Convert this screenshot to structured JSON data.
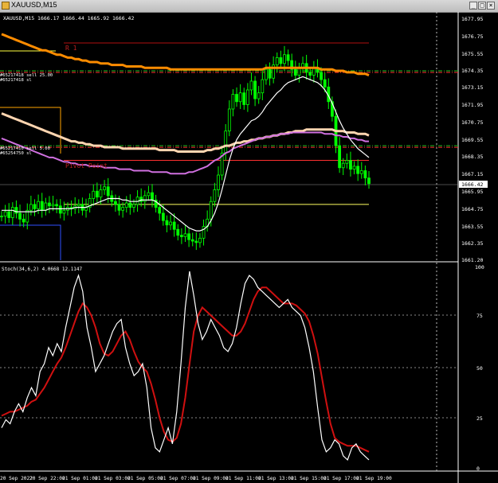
{
  "window": {
    "title": "XAUUSD,M15",
    "min_glyph": "_",
    "max_glyph": "□",
    "close_glyph": "×"
  },
  "price_panel": {
    "ohlc_text": "XAUUSD,M15  1666.17 1666.44 1665.92 1666.42",
    "current_price": "1666.42",
    "price_labels": [
      "1677.95",
      "1676.75",
      "1675.55",
      "1674.35",
      "1673.15",
      "1671.95",
      "1670.75",
      "1669.55",
      "1668.35",
      "1667.15",
      "1665.95",
      "1664.75",
      "1663.55",
      "1662.35",
      "1661.20"
    ],
    "r1_label": "R 1",
    "pivot_label": "Pivot Point",
    "order_labels": [
      "#65217418 sell 25.00",
      "#65217418 sl",
      "#65217410 sell 5.00",
      "#65254750 sl"
    ],
    "colors": {
      "candle": "#00ff00",
      "ma_orange": "#ff8c00",
      "ma_peach": "#ffd5b0",
      "ma_violet": "#d070e0",
      "fast_ma": "#ffffff"
    }
  },
  "stoch_panel": {
    "label": "Stoch(34,6,2) 4.0668 12.1147",
    "levels": [
      "100",
      "75",
      "50",
      "25",
      "0"
    ],
    "colors": {
      "main": "#ffffff",
      "signal": "#d01010"
    }
  },
  "time_axis": {
    "labels": [
      "20 Sep 2022",
      "20 Sep 22:00",
      "21 Sep 01:00",
      "21 Sep 03:00",
      "21 Sep 05:00",
      "21 Sep 07:00",
      "21 Sep 09:00",
      "21 Sep 11:00",
      "21 Sep 13:00",
      "21 Sep 15:00",
      "21 Sep 17:00",
      "21 Sep 19:00"
    ]
  },
  "chart_data": {
    "type": "candlestick",
    "symbol": "XAUUSD",
    "timeframe": "M15",
    "ylim": [
      1661.2,
      1677.95
    ],
    "last_price": 1666.42,
    "levels": {
      "r1": 1676.0,
      "pivot": 1668.0,
      "order_sell_1": 1674.1,
      "order_sell_2": 1669.0,
      "yellow": 1665.0
    },
    "closes": [
      1664.2,
      1664.5,
      1664.1,
      1664.8,
      1664.4,
      1664.0,
      1663.8,
      1664.6,
      1665.0,
      1664.7,
      1665.2,
      1664.6,
      1665.1,
      1664.9,
      1665.0,
      1664.9,
      1664.4,
      1664.6,
      1664.8,
      1664.7,
      1664.9,
      1665.0,
      1664.6,
      1664.8,
      1665.4,
      1665.9,
      1665.5,
      1666.0,
      1666.2,
      1665.6,
      1665.2,
      1665.0,
      1664.6,
      1664.8,
      1665.1,
      1664.8,
      1665.0,
      1665.5,
      1665.2,
      1665.6,
      1665.8,
      1665.3,
      1664.8,
      1664.4,
      1663.9,
      1663.6,
      1663.8,
      1663.3,
      1662.9,
      1662.8,
      1663.0,
      1662.6,
      1662.5,
      1662.4,
      1662.7,
      1663.5,
      1664.0,
      1665.2,
      1666.0,
      1667.0,
      1668.5,
      1670.0,
      1671.5,
      1672.5,
      1672.0,
      1672.6,
      1671.8,
      1672.8,
      1673.4,
      1672.2,
      1672.6,
      1673.5,
      1674.2,
      1673.6,
      1674.5,
      1675.0,
      1674.6,
      1675.2,
      1674.8,
      1674.2,
      1673.8,
      1674.3,
      1674.6,
      1674.0,
      1673.8,
      1674.3,
      1674.0,
      1673.5,
      1673.0,
      1672.0,
      1671.0,
      1669.0,
      1667.5,
      1667.8,
      1668.0,
      1667.4,
      1667.6,
      1667.1,
      1667.3,
      1666.8,
      1666.42
    ],
    "ma_fast": [
      1664.6,
      1664.6,
      1664.6,
      1664.6,
      1664.5,
      1664.5,
      1664.5,
      1664.5,
      1664.5,
      1664.5,
      1664.6,
      1664.6,
      1664.6,
      1664.7,
      1664.7,
      1664.7,
      1664.7,
      1664.7,
      1664.7,
      1664.7,
      1664.8,
      1664.8,
      1664.8,
      1664.8,
      1664.9,
      1665.0,
      1665.1,
      1665.2,
      1665.3,
      1665.4,
      1665.4,
      1665.4,
      1665.4,
      1665.3,
      1665.3,
      1665.2,
      1665.2,
      1665.2,
      1665.3,
      1665.3,
      1665.3,
      1665.3,
      1665.2,
      1665.0,
      1664.8,
      1664.6,
      1664.4,
      1664.2,
      1664.0,
      1663.8,
      1663.6,
      1663.4,
      1663.3,
      1663.2,
      1663.2,
      1663.3,
      1663.5,
      1663.9,
      1664.4,
      1665.1,
      1666.0,
      1667.0,
      1668.0,
      1668.8,
      1669.4,
      1669.8,
      1670.1,
      1670.4,
      1670.7,
      1670.8,
      1671.0,
      1671.3,
      1671.7,
      1672.0,
      1672.3,
      1672.6,
      1672.8,
      1673.1,
      1673.3,
      1673.4,
      1673.5,
      1673.6,
      1673.7,
      1673.6,
      1673.5,
      1673.4,
      1673.3,
      1673.1,
      1672.8,
      1672.4,
      1671.9,
      1671.3,
      1670.7,
      1670.2,
      1669.8,
      1669.4,
      1669.1,
      1668.8,
      1668.6,
      1668.4,
      1668.2
    ],
    "ma_orange": [
      1676.6,
      1676.5,
      1676.4,
      1676.3,
      1676.2,
      1676.1,
      1676.0,
      1675.9,
      1675.8,
      1675.7,
      1675.6,
      1675.5,
      1675.5,
      1675.4,
      1675.3,
      1675.2,
      1675.2,
      1675.1,
      1675.0,
      1675.0,
      1674.9,
      1674.9,
      1674.8,
      1674.8,
      1674.7,
      1674.7,
      1674.7,
      1674.6,
      1674.6,
      1674.6,
      1674.5,
      1674.5,
      1674.5,
      1674.5,
      1674.4,
      1674.4,
      1674.4,
      1674.4,
      1674.4,
      1674.3,
      1674.3,
      1674.3,
      1674.3,
      1674.3,
      1674.3,
      1674.3,
      1674.2,
      1674.2,
      1674.2,
      1674.2,
      1674.2,
      1674.2,
      1674.2,
      1674.2,
      1674.2,
      1674.2,
      1674.2,
      1674.2,
      1674.2,
      1674.2,
      1674.2,
      1674.2,
      1674.2,
      1674.2,
      1674.2,
      1674.2,
      1674.2,
      1674.2,
      1674.2,
      1674.2,
      1674.2,
      1674.2,
      1674.3,
      1674.3,
      1674.3,
      1674.3,
      1674.3,
      1674.3,
      1674.3,
      1674.3,
      1674.3,
      1674.3,
      1674.3,
      1674.3,
      1674.3,
      1674.3,
      1674.3,
      1674.2,
      1674.2,
      1674.2,
      1674.2,
      1674.1,
      1674.1,
      1674.1,
      1674.0,
      1674.0,
      1674.0,
      1673.9,
      1673.9,
      1673.9,
      1673.8
    ],
    "ma_peach": [
      1671.2,
      1671.1,
      1671.0,
      1670.9,
      1670.8,
      1670.7,
      1670.6,
      1670.5,
      1670.4,
      1670.3,
      1670.2,
      1670.1,
      1670.0,
      1669.9,
      1669.8,
      1669.7,
      1669.6,
      1669.5,
      1669.4,
      1669.3,
      1669.3,
      1669.2,
      1669.2,
      1669.1,
      1669.1,
      1669.0,
      1669.0,
      1669.0,
      1668.9,
      1668.9,
      1668.9,
      1668.9,
      1668.9,
      1668.8,
      1668.8,
      1668.8,
      1668.8,
      1668.8,
      1668.8,
      1668.8,
      1668.8,
      1668.8,
      1668.8,
      1668.7,
      1668.7,
      1668.7,
      1668.7,
      1668.7,
      1668.6,
      1668.6,
      1668.6,
      1668.6,
      1668.6,
      1668.6,
      1668.6,
      1668.6,
      1668.7,
      1668.7,
      1668.8,
      1668.8,
      1668.9,
      1669.0,
      1669.0,
      1669.1,
      1669.2,
      1669.2,
      1669.3,
      1669.3,
      1669.4,
      1669.4,
      1669.5,
      1669.5,
      1669.6,
      1669.6,
      1669.7,
      1669.7,
      1669.8,
      1669.8,
      1669.9,
      1669.9,
      1670.0,
      1670.0,
      1670.0,
      1670.1,
      1670.1,
      1670.1,
      1670.1,
      1670.1,
      1670.1,
      1670.1,
      1670.1,
      1670.0,
      1670.0,
      1670.0,
      1669.9,
      1669.9,
      1669.9,
      1669.8,
      1669.8,
      1669.8,
      1669.7
    ],
    "ma_violet": [
      1669.5,
      1669.4,
      1669.3,
      1669.2,
      1669.1,
      1669.0,
      1668.9,
      1668.8,
      1668.7,
      1668.6,
      1668.5,
      1668.4,
      1668.3,
      1668.2,
      1668.2,
      1668.1,
      1668.0,
      1667.9,
      1667.9,
      1667.8,
      1667.8,
      1667.7,
      1667.7,
      1667.7,
      1667.6,
      1667.6,
      1667.6,
      1667.6,
      1667.5,
      1667.5,
      1667.5,
      1667.5,
      1667.4,
      1667.4,
      1667.4,
      1667.4,
      1667.3,
      1667.3,
      1667.3,
      1667.3,
      1667.3,
      1667.2,
      1667.2,
      1667.2,
      1667.2,
      1667.2,
      1667.1,
      1667.1,
      1667.1,
      1667.1,
      1667.1,
      1667.2,
      1667.2,
      1667.3,
      1667.4,
      1667.5,
      1667.6,
      1667.8,
      1668.0,
      1668.1,
      1668.3,
      1668.5,
      1668.6,
      1668.8,
      1668.9,
      1669.0,
      1669.1,
      1669.2,
      1669.3,
      1669.4,
      1669.5,
      1669.5,
      1669.6,
      1669.6,
      1669.7,
      1669.7,
      1669.8,
      1669.8,
      1669.8,
      1669.9,
      1669.9,
      1669.9,
      1669.9,
      1669.9,
      1669.9,
      1669.9,
      1669.9,
      1669.9,
      1669.8,
      1669.8,
      1669.8,
      1669.7,
      1669.7,
      1669.6,
      1669.6,
      1669.5,
      1669.5,
      1669.4,
      1669.4,
      1669.3,
      1669.3
    ],
    "stoch_main": [
      20,
      24,
      22,
      28,
      32,
      28,
      35,
      40,
      36,
      48,
      52,
      60,
      56,
      62,
      58,
      70,
      80,
      90,
      96,
      88,
      70,
      60,
      48,
      52,
      56,
      62,
      68,
      72,
      74,
      60,
      52,
      46,
      48,
      52,
      40,
      20,
      10,
      8,
      14,
      20,
      12,
      28,
      52,
      80,
      98,
      86,
      72,
      64,
      68,
      74,
      70,
      66,
      60,
      58,
      62,
      70,
      82,
      92,
      96,
      94,
      90,
      88,
      86,
      84,
      82,
      80,
      82,
      84,
      80,
      78,
      76,
      70,
      60,
      48,
      30,
      14,
      8,
      10,
      14,
      12,
      6,
      4,
      10,
      12,
      8,
      6,
      4
    ],
    "stoch_signal": [
      26,
      27,
      28,
      28,
      29,
      30,
      31,
      33,
      34,
      37,
      40,
      44,
      48,
      52,
      55,
      60,
      66,
      72,
      78,
      82,
      80,
      76,
      70,
      62,
      57,
      56,
      58,
      62,
      66,
      68,
      64,
      58,
      53,
      50,
      48,
      42,
      34,
      25,
      18,
      14,
      13,
      15,
      22,
      35,
      52,
      68,
      76,
      80,
      78,
      76,
      74,
      72,
      70,
      68,
      66,
      66,
      68,
      72,
      78,
      84,
      88,
      90,
      90,
      88,
      86,
      84,
      82,
      82,
      82,
      81,
      79,
      77,
      73,
      66,
      57,
      45,
      33,
      22,
      15,
      13,
      12,
      11,
      11,
      11,
      10,
      9,
      8
    ]
  }
}
